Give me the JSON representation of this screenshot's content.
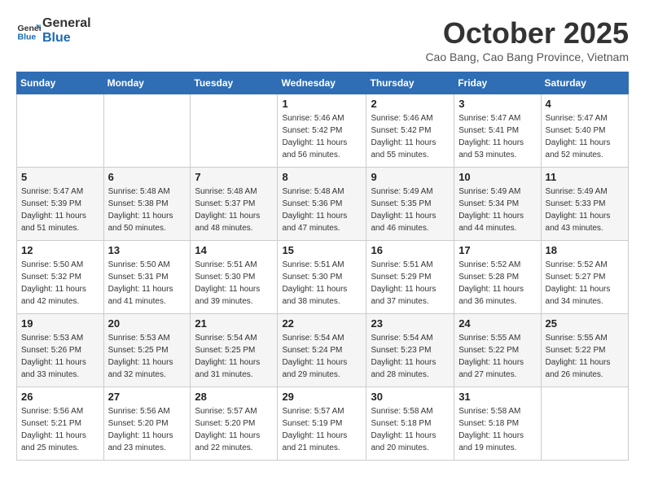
{
  "header": {
    "logo_line1": "General",
    "logo_line2": "Blue",
    "month_title": "October 2025",
    "location": "Cao Bang, Cao Bang Province, Vietnam"
  },
  "weekdays": [
    "Sunday",
    "Monday",
    "Tuesday",
    "Wednesday",
    "Thursday",
    "Friday",
    "Saturday"
  ],
  "weeks": [
    [
      {
        "day": "",
        "info": ""
      },
      {
        "day": "",
        "info": ""
      },
      {
        "day": "",
        "info": ""
      },
      {
        "day": "1",
        "info": "Sunrise: 5:46 AM\nSunset: 5:42 PM\nDaylight: 11 hours\nand 56 minutes."
      },
      {
        "day": "2",
        "info": "Sunrise: 5:46 AM\nSunset: 5:42 PM\nDaylight: 11 hours\nand 55 minutes."
      },
      {
        "day": "3",
        "info": "Sunrise: 5:47 AM\nSunset: 5:41 PM\nDaylight: 11 hours\nand 53 minutes."
      },
      {
        "day": "4",
        "info": "Sunrise: 5:47 AM\nSunset: 5:40 PM\nDaylight: 11 hours\nand 52 minutes."
      }
    ],
    [
      {
        "day": "5",
        "info": "Sunrise: 5:47 AM\nSunset: 5:39 PM\nDaylight: 11 hours\nand 51 minutes."
      },
      {
        "day": "6",
        "info": "Sunrise: 5:48 AM\nSunset: 5:38 PM\nDaylight: 11 hours\nand 50 minutes."
      },
      {
        "day": "7",
        "info": "Sunrise: 5:48 AM\nSunset: 5:37 PM\nDaylight: 11 hours\nand 48 minutes."
      },
      {
        "day": "8",
        "info": "Sunrise: 5:48 AM\nSunset: 5:36 PM\nDaylight: 11 hours\nand 47 minutes."
      },
      {
        "day": "9",
        "info": "Sunrise: 5:49 AM\nSunset: 5:35 PM\nDaylight: 11 hours\nand 46 minutes."
      },
      {
        "day": "10",
        "info": "Sunrise: 5:49 AM\nSunset: 5:34 PM\nDaylight: 11 hours\nand 44 minutes."
      },
      {
        "day": "11",
        "info": "Sunrise: 5:49 AM\nSunset: 5:33 PM\nDaylight: 11 hours\nand 43 minutes."
      }
    ],
    [
      {
        "day": "12",
        "info": "Sunrise: 5:50 AM\nSunset: 5:32 PM\nDaylight: 11 hours\nand 42 minutes."
      },
      {
        "day": "13",
        "info": "Sunrise: 5:50 AM\nSunset: 5:31 PM\nDaylight: 11 hours\nand 41 minutes."
      },
      {
        "day": "14",
        "info": "Sunrise: 5:51 AM\nSunset: 5:30 PM\nDaylight: 11 hours\nand 39 minutes."
      },
      {
        "day": "15",
        "info": "Sunrise: 5:51 AM\nSunset: 5:30 PM\nDaylight: 11 hours\nand 38 minutes."
      },
      {
        "day": "16",
        "info": "Sunrise: 5:51 AM\nSunset: 5:29 PM\nDaylight: 11 hours\nand 37 minutes."
      },
      {
        "day": "17",
        "info": "Sunrise: 5:52 AM\nSunset: 5:28 PM\nDaylight: 11 hours\nand 36 minutes."
      },
      {
        "day": "18",
        "info": "Sunrise: 5:52 AM\nSunset: 5:27 PM\nDaylight: 11 hours\nand 34 minutes."
      }
    ],
    [
      {
        "day": "19",
        "info": "Sunrise: 5:53 AM\nSunset: 5:26 PM\nDaylight: 11 hours\nand 33 minutes."
      },
      {
        "day": "20",
        "info": "Sunrise: 5:53 AM\nSunset: 5:25 PM\nDaylight: 11 hours\nand 32 minutes."
      },
      {
        "day": "21",
        "info": "Sunrise: 5:54 AM\nSunset: 5:25 PM\nDaylight: 11 hours\nand 31 minutes."
      },
      {
        "day": "22",
        "info": "Sunrise: 5:54 AM\nSunset: 5:24 PM\nDaylight: 11 hours\nand 29 minutes."
      },
      {
        "day": "23",
        "info": "Sunrise: 5:54 AM\nSunset: 5:23 PM\nDaylight: 11 hours\nand 28 minutes."
      },
      {
        "day": "24",
        "info": "Sunrise: 5:55 AM\nSunset: 5:22 PM\nDaylight: 11 hours\nand 27 minutes."
      },
      {
        "day": "25",
        "info": "Sunrise: 5:55 AM\nSunset: 5:22 PM\nDaylight: 11 hours\nand 26 minutes."
      }
    ],
    [
      {
        "day": "26",
        "info": "Sunrise: 5:56 AM\nSunset: 5:21 PM\nDaylight: 11 hours\nand 25 minutes."
      },
      {
        "day": "27",
        "info": "Sunrise: 5:56 AM\nSunset: 5:20 PM\nDaylight: 11 hours\nand 23 minutes."
      },
      {
        "day": "28",
        "info": "Sunrise: 5:57 AM\nSunset: 5:20 PM\nDaylight: 11 hours\nand 22 minutes."
      },
      {
        "day": "29",
        "info": "Sunrise: 5:57 AM\nSunset: 5:19 PM\nDaylight: 11 hours\nand 21 minutes."
      },
      {
        "day": "30",
        "info": "Sunrise: 5:58 AM\nSunset: 5:18 PM\nDaylight: 11 hours\nand 20 minutes."
      },
      {
        "day": "31",
        "info": "Sunrise: 5:58 AM\nSunset: 5:18 PM\nDaylight: 11 hours\nand 19 minutes."
      },
      {
        "day": "",
        "info": ""
      }
    ]
  ]
}
